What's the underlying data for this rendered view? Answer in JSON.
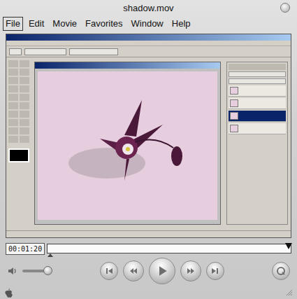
{
  "window": {
    "title": "shadow.mov"
  },
  "menu": [
    {
      "label": "File",
      "selected": true
    },
    {
      "label": "Edit",
      "selected": false
    },
    {
      "label": "Movie",
      "selected": false
    },
    {
      "label": "Favorites",
      "selected": false
    },
    {
      "label": "Window",
      "selected": false
    },
    {
      "label": "Help",
      "selected": false
    }
  ],
  "timeline": {
    "time": "00:01:20",
    "level": 0.99
  },
  "volume": {
    "level": 0.86
  }
}
